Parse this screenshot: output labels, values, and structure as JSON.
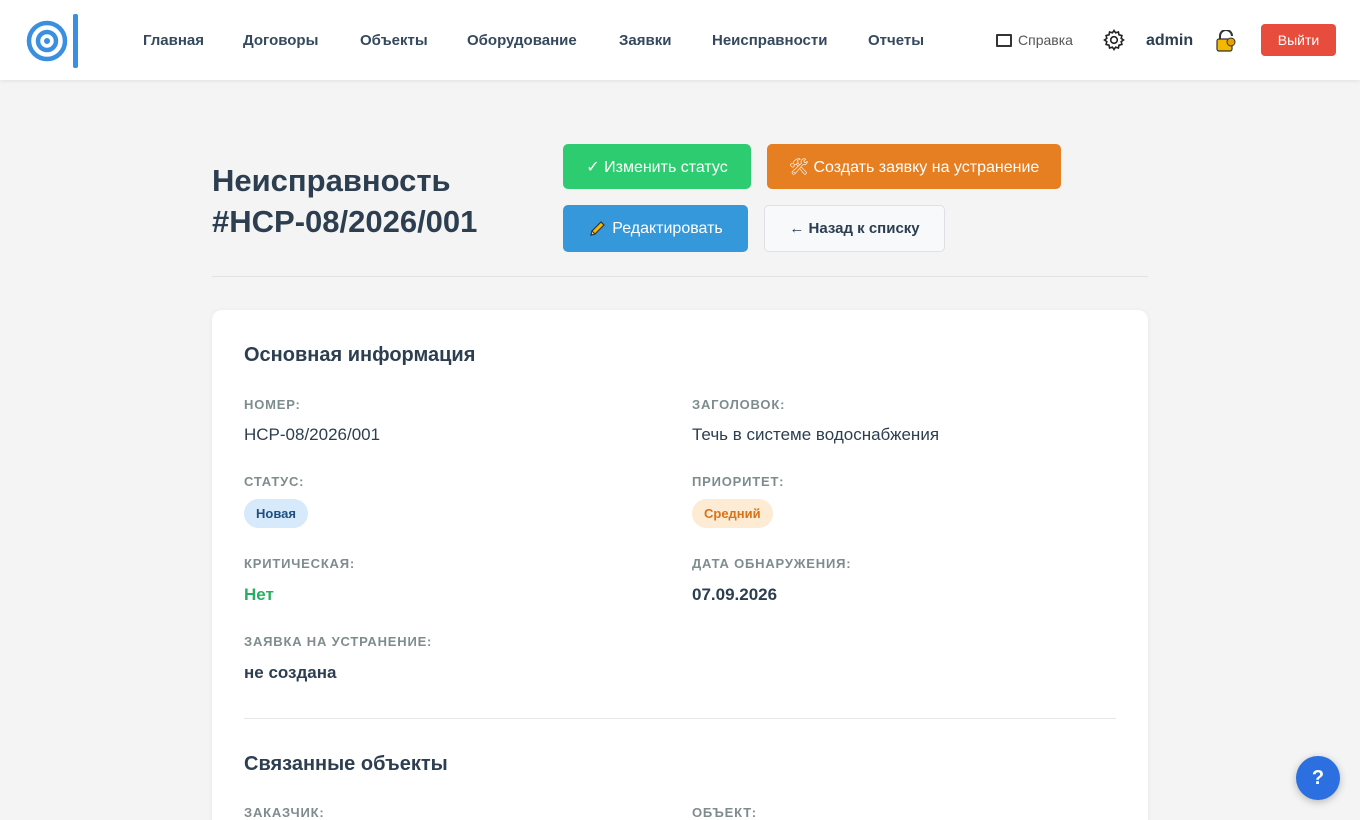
{
  "nav": {
    "items": [
      "Главная",
      "Договоры",
      "Объекты",
      "Оборудование",
      "Заявки",
      "Неисправности",
      "Отчеты"
    ],
    "help_label": "Справка",
    "user_name": "admin",
    "logout_label": "Выйти"
  },
  "page": {
    "title": "Неисправность #НСР-08/2026/001",
    "actions": {
      "change_status": "✓ Изменить статус",
      "create_request": "🛠 Создать заявку на устранение",
      "edit": "Редактировать",
      "edit_icon": "pencil-icon",
      "back": "← Назад к списку"
    }
  },
  "main_info": {
    "title": "Основная информация",
    "number_label": "Номер:",
    "number_value": "НСР-08/2026/001",
    "heading_label": "Заголовок:",
    "heading_value": "Течь в системе водоснабжения",
    "status_label": "Статус:",
    "status_value": "Новая",
    "priority_label": "Приоритет:",
    "priority_value": "Средний",
    "critical_label": "Критическая:",
    "critical_value": "Нет",
    "date_label": "Дата обнаружения:",
    "date_value": "07.09.2026",
    "request_label": "Заявка на устранение:",
    "request_value": "не создана"
  },
  "related": {
    "title": "Связанные объекты",
    "customer_label": "Заказчик:",
    "object_label": "Объект:"
  },
  "fab": {
    "label": "?"
  },
  "colors": {
    "accent_blue": "#3498db",
    "success": "#2ecc71",
    "warning": "#e67e22",
    "danger": "#e74c3c"
  }
}
